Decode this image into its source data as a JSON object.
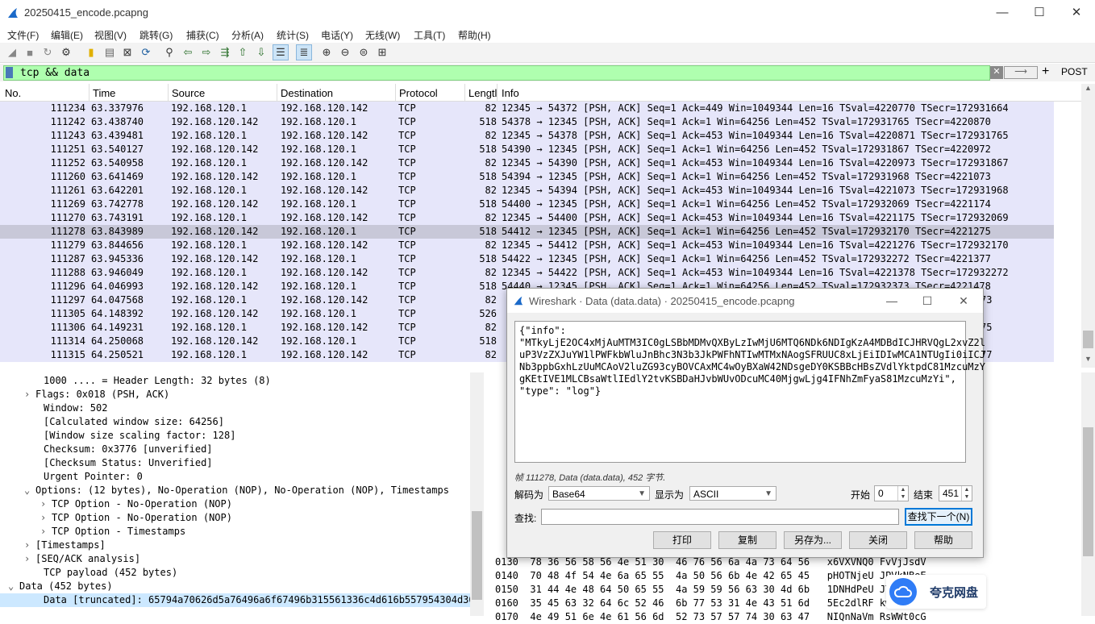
{
  "window": {
    "title": "20250415_encode.pcapng",
    "minimize": "—",
    "maximize": "☐",
    "close": "✕"
  },
  "menu": [
    "文件(F)",
    "编辑(E)",
    "视图(V)",
    "跳转(G)",
    "捕获(C)",
    "分析(A)",
    "统计(S)",
    "电话(Y)",
    "无线(W)",
    "工具(T)",
    "帮助(H)"
  ],
  "toolbar": {
    "icons": [
      "shark-fin-icon",
      "stop-icon",
      "restart-icon",
      "options-gear-icon",
      "open-file-icon",
      "save-file-icon",
      "close-file-icon",
      "reload-icon",
      "find-packet-icon",
      "go-back-icon",
      "go-forward-icon",
      "go-to-packet-icon",
      "first-packet-icon",
      "last-packet-icon",
      "autoscroll-icon",
      "colorize-icon",
      "zoom-in-icon",
      "zoom-out-icon",
      "zoom-reset-icon",
      "resize-columns-icon"
    ]
  },
  "filter": {
    "value": "tcp && data",
    "clear_label": "✕",
    "apply_label": "⟶",
    "add_label": "+",
    "post_label": "POST"
  },
  "packet_list": {
    "columns": [
      "No.",
      "Time",
      "Source",
      "Destination",
      "Protocol",
      "Lengtl",
      "Info"
    ],
    "rows": [
      {
        "no": "111234",
        "time": "63.337976",
        "src": "192.168.120.1",
        "dst": "192.168.120.142",
        "proto": "TCP",
        "len": "82",
        "info": "12345 → 54372 [PSH, ACK] Seq=1 Ack=449 Win=1049344 Len=16 TSval=4220770 TSecr=172931664"
      },
      {
        "no": "111242",
        "time": "63.438740",
        "src": "192.168.120.142",
        "dst": "192.168.120.1",
        "proto": "TCP",
        "len": "518",
        "info": "54378 → 12345 [PSH, ACK] Seq=1 Ack=1 Win=64256 Len=452 TSval=172931765 TSecr=4220870"
      },
      {
        "no": "111243",
        "time": "63.439481",
        "src": "192.168.120.1",
        "dst": "192.168.120.142",
        "proto": "TCP",
        "len": "82",
        "info": "12345 → 54378 [PSH, ACK] Seq=1 Ack=453 Win=1049344 Len=16 TSval=4220871 TSecr=172931765"
      },
      {
        "no": "111251",
        "time": "63.540127",
        "src": "192.168.120.142",
        "dst": "192.168.120.1",
        "proto": "TCP",
        "len": "518",
        "info": "54390 → 12345 [PSH, ACK] Seq=1 Ack=1 Win=64256 Len=452 TSval=172931867 TSecr=4220972"
      },
      {
        "no": "111252",
        "time": "63.540958",
        "src": "192.168.120.1",
        "dst": "192.168.120.142",
        "proto": "TCP",
        "len": "82",
        "info": "12345 → 54390 [PSH, ACK] Seq=1 Ack=453 Win=1049344 Len=16 TSval=4220973 TSecr=172931867"
      },
      {
        "no": "111260",
        "time": "63.641469",
        "src": "192.168.120.142",
        "dst": "192.168.120.1",
        "proto": "TCP",
        "len": "518",
        "info": "54394 → 12345 [PSH, ACK] Seq=1 Ack=1 Win=64256 Len=452 TSval=172931968 TSecr=4221073"
      },
      {
        "no": "111261",
        "time": "63.642201",
        "src": "192.168.120.1",
        "dst": "192.168.120.142",
        "proto": "TCP",
        "len": "82",
        "info": "12345 → 54394 [PSH, ACK] Seq=1 Ack=453 Win=1049344 Len=16 TSval=4221073 TSecr=172931968"
      },
      {
        "no": "111269",
        "time": "63.742778",
        "src": "192.168.120.142",
        "dst": "192.168.120.1",
        "proto": "TCP",
        "len": "518",
        "info": "54400 → 12345 [PSH, ACK] Seq=1 Ack=1 Win=64256 Len=452 TSval=172932069 TSecr=4221174"
      },
      {
        "no": "111270",
        "time": "63.743191",
        "src": "192.168.120.1",
        "dst": "192.168.120.142",
        "proto": "TCP",
        "len": "82",
        "info": "12345 → 54400 [PSH, ACK] Seq=1 Ack=453 Win=1049344 Len=16 TSval=4221175 TSecr=172932069"
      },
      {
        "no": "111278",
        "time": "63.843989",
        "src": "192.168.120.142",
        "dst": "192.168.120.1",
        "proto": "TCP",
        "len": "518",
        "info": "54412 → 12345 [PSH, ACK] Seq=1 Ack=1 Win=64256 Len=452 TSval=172932170 TSecr=4221275"
      },
      {
        "no": "111279",
        "time": "63.844656",
        "src": "192.168.120.1",
        "dst": "192.168.120.142",
        "proto": "TCP",
        "len": "82",
        "info": "12345 → 54412 [PSH, ACK] Seq=1 Ack=453 Win=1049344 Len=16 TSval=4221276 TSecr=172932170"
      },
      {
        "no": "111287",
        "time": "63.945336",
        "src": "192.168.120.142",
        "dst": "192.168.120.1",
        "proto": "TCP",
        "len": "518",
        "info": "54422 → 12345 [PSH, ACK] Seq=1 Ack=1 Win=64256 Len=452 TSval=172932272 TSecr=4221377"
      },
      {
        "no": "111288",
        "time": "63.946049",
        "src": "192.168.120.1",
        "dst": "192.168.120.142",
        "proto": "TCP",
        "len": "82",
        "info": "12345 → 54422 [PSH, ACK] Seq=1 Ack=453 Win=1049344 Len=16 TSval=4221378 TSecr=172932272"
      },
      {
        "no": "111296",
        "time": "64.046993",
        "src": "192.168.120.142",
        "dst": "192.168.120.1",
        "proto": "TCP",
        "len": "518",
        "info": "54440 → 12345 [PSH, ACK] Seq=1 Ack=1 Win=64256 Len=452 TSval=172932373 TSecr=4221478"
      },
      {
        "no": "111297",
        "time": "64.047568",
        "src": "192.168.120.1",
        "dst": "192.168.120.142",
        "proto": "TCP",
        "len": "82",
        "info": "73"
      },
      {
        "no": "111305",
        "time": "64.148392",
        "src": "192.168.120.142",
        "dst": "192.168.120.1",
        "proto": "TCP",
        "len": "526",
        "info": ""
      },
      {
        "no": "111306",
        "time": "64.149231",
        "src": "192.168.120.1",
        "dst": "192.168.120.142",
        "proto": "TCP",
        "len": "82",
        "info": "75"
      },
      {
        "no": "111314",
        "time": "64.250068",
        "src": "192.168.120.142",
        "dst": "192.168.120.1",
        "proto": "TCP",
        "len": "518",
        "info": ""
      },
      {
        "no": "111315",
        "time": "64.250521",
        "src": "192.168.120.1",
        "dst": "192.168.120.142",
        "proto": "TCP",
        "len": "82",
        "info": "77"
      }
    ],
    "selected_row": "111278",
    "row_color": "#e6e6fa",
    "selected_color": "#c8c8d8"
  },
  "details": {
    "lines": [
      {
        "indent": 3,
        "exp": "",
        "text": "1000 .... = Header Length: 32 bytes (8)"
      },
      {
        "indent": 2,
        "exp": ">",
        "text": "Flags: 0x018 (PSH, ACK)"
      },
      {
        "indent": 3,
        "exp": "",
        "text": "Window: 502"
      },
      {
        "indent": 3,
        "exp": "",
        "text": "[Calculated window size: 64256]"
      },
      {
        "indent": 3,
        "exp": "",
        "text": "[Window size scaling factor: 128]"
      },
      {
        "indent": 3,
        "exp": "",
        "text": "Checksum: 0x3776 [unverified]"
      },
      {
        "indent": 3,
        "exp": "",
        "text": "[Checksum Status: Unverified]"
      },
      {
        "indent": 3,
        "exp": "",
        "text": "Urgent Pointer: 0"
      },
      {
        "indent": 2,
        "exp": "v",
        "text": "Options: (12 bytes), No-Operation (NOP), No-Operation (NOP), Timestamps"
      },
      {
        "indent": 4,
        "exp": ">",
        "text": "TCP Option - No-Operation (NOP)"
      },
      {
        "indent": 4,
        "exp": ">",
        "text": "TCP Option - No-Operation (NOP)"
      },
      {
        "indent": 4,
        "exp": ">",
        "text": "TCP Option - Timestamps"
      },
      {
        "indent": 2,
        "exp": ">",
        "text": "[Timestamps]"
      },
      {
        "indent": 2,
        "exp": ">",
        "text": "[SEQ/ACK analysis]"
      },
      {
        "indent": 3,
        "exp": "",
        "text": "TCP payload (452 bytes)"
      },
      {
        "indent": 0,
        "exp": "v",
        "text": "Data (452 bytes)"
      },
      {
        "indent": 3,
        "exp": "",
        "text": "Data [truncated]: 65794a70626d5a76496a6f67496b315561336c4d616b557954304d30654"
      }
    ],
    "selected_line": 16
  },
  "bytes": {
    "lines": [
      "0130  78 36 56 58 56 4e 51 30  46 76 56 6a 4a 73 64 56   x6VXVNQ0 FvVjJsdV",
      "0140  70 48 4f 54 4e 6a 65 55  4a 50 56 6b 4e 42 65 45   pHOTNjeU JPVkNBeE",
      "0150  31 44 4e 48 64 50 65 55  4a 59 59 56 63 30 4d 6b   1DNHdPeU JYYVc0Mk",
      "0160  35 45 63 32 64 6c 52 46  6b 77 53 31 4e 43 51 6d   5Ec2dlRF kwS1NCQm",
      "0170  4e 49 51 6e 4e 61 56 6d  52 73 57 57 74 30 63 47   NIQnNaVm RsWWt0cG"
    ]
  },
  "dialog": {
    "title": "Wireshark · Data (data.data) · 20250415_encode.pcapng",
    "content_lines": [
      "{\"info\":",
      "\"MTkyLjE2OC4xMjAuMTM3IC0gLSBbMDMvQXByLzIwMjU6MTQ6NDk6NDIgKzA4MDBdICJHRVQgL2xvZ2l",
      "uP3VzZXJuYW1lPWFkbWluJnBhc3N3b3JkPWFhNTIwMTMxNAogSFRUUC8xLjEiIDIwMCA1NTUgIi0iICJ",
      "Nb3ppbGxhLzUuMCAoV2luZG93cyBOVCAxMC4wOyBXaW42NDsgeDY0KSBBcHBsZVdlYktpdC81MzcuMzY",
      "gKEtIVE1MLCBsaWtlIEdlY2tvKSBDaHJvbWUvODcuMC40MjgwLjg4IFNhZmFyaS81MzcuMzYi\",",
      "\"type\": \"log\"}"
    ],
    "status": "帧 111278, Data (data.data), 452 字节.",
    "decode_label": "解码为",
    "decode_value": "Base64",
    "show_label": "显示为",
    "show_value": "ASCII",
    "start_label": "开始",
    "start_value": "0",
    "end_label": "结束",
    "end_value": "451",
    "find_label": "查找:",
    "find_next": "查找下一个(N)",
    "print": "打印",
    "copy": "复制",
    "save_as": "另存为...",
    "close": "关闭",
    "help": "帮助",
    "minimize": "—",
    "maximize": "☐",
    "close_x": "✕"
  },
  "watermark": {
    "text": "夸克网盘"
  }
}
